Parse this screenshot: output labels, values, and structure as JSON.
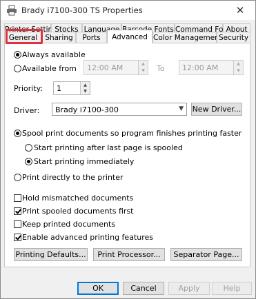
{
  "window": {
    "title": "Brady i7100-300 TS Properties",
    "close_glyph": "✕"
  },
  "tabs_row1": [
    "Printer Settings",
    "Stocks",
    "Language",
    "Barcode Fonts",
    "Command Fonts",
    "About"
  ],
  "tabs_row2": [
    "General",
    "Sharing",
    "Ports",
    "Advanced",
    "Color Management",
    "Security"
  ],
  "active_tab": "Advanced",
  "availability": {
    "always_label": "Always available",
    "from_label": "Available from",
    "from_time": "12:00 AM",
    "to_label": "To",
    "to_time": "12:00 AM",
    "selected": "always"
  },
  "priority": {
    "label": "Priority:",
    "value": "1"
  },
  "driver": {
    "label": "Driver:",
    "value": "Brady i7100-300",
    "new_driver_label": "New Driver..."
  },
  "spool": {
    "spool_label": "Spool print documents so program finishes printing faster",
    "after_last_page_label": "Start printing after last page is spooled",
    "immediately_label": "Start printing immediately",
    "direct_label": "Print directly to the printer"
  },
  "options": {
    "hold_mismatched": {
      "label": "Hold mismatched documents",
      "checked": false
    },
    "spooled_first": {
      "label": "Print spooled documents first",
      "checked": true
    },
    "keep_printed": {
      "label": "Keep printed documents",
      "checked": false
    },
    "advanced_features": {
      "label": "Enable advanced printing features",
      "checked": true
    }
  },
  "panel_buttons": {
    "defaults": "Printing Defaults...",
    "processor": "Print Processor...",
    "separator": "Separator Page..."
  },
  "dialog_buttons": {
    "ok": "OK",
    "cancel": "Cancel",
    "apply": "Apply",
    "help": "Help"
  },
  "colors": {
    "highlight": "#e0313f",
    "accent": "#0078d7"
  }
}
